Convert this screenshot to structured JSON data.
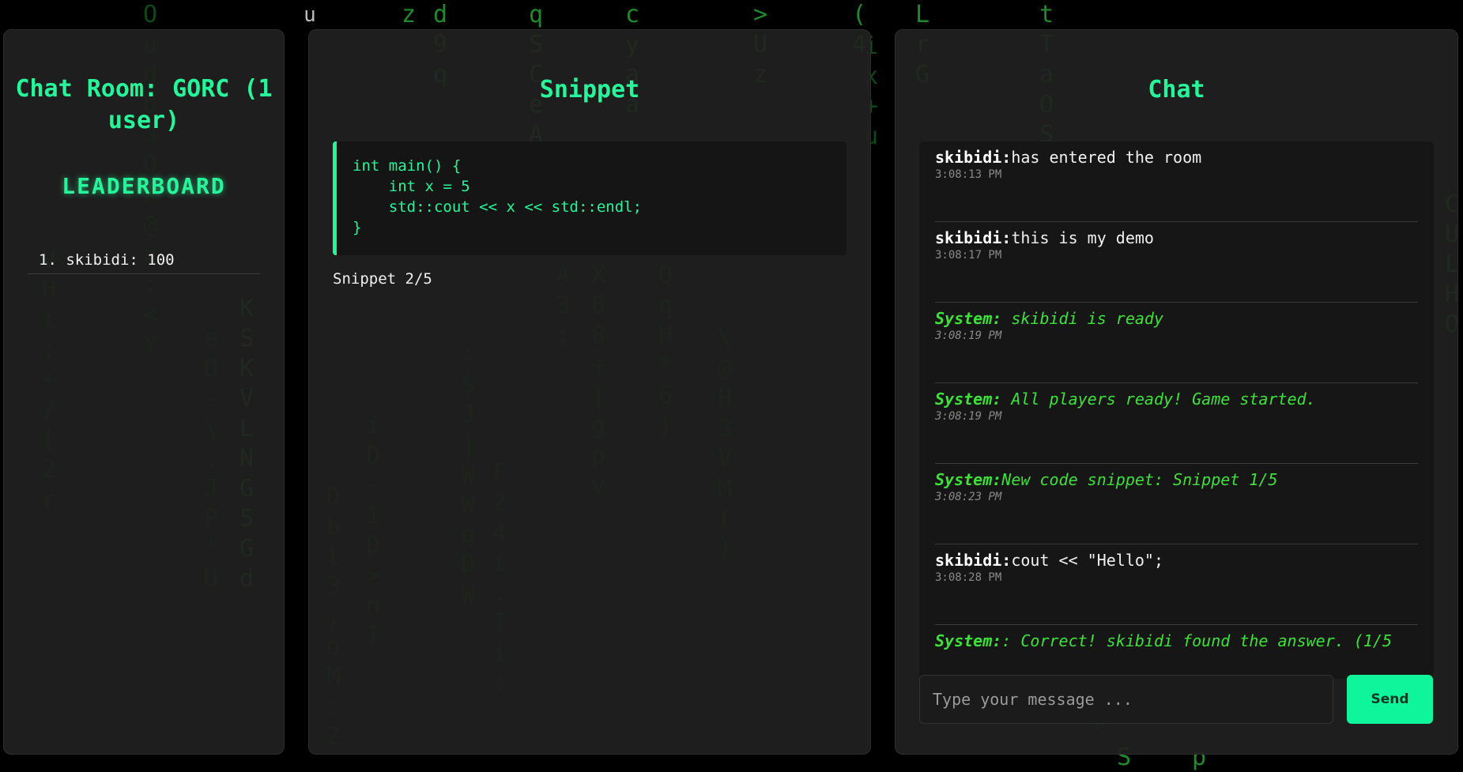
{
  "left": {
    "room_title": "Chat Room: GORC (1 user)",
    "leaderboard_title": "LEADERBOARD",
    "leaderboard": [
      "1. skibidi: 100"
    ]
  },
  "snippet": {
    "title": "Snippet",
    "code": [
      "int main() {",
      "    int x = 5",
      "    std::cout << x << std::endl;",
      "}"
    ],
    "counter": "Snippet 2/5"
  },
  "chat": {
    "title": "Chat",
    "messages": [
      {
        "user": "skibidi:",
        "text": "has entered the room",
        "time": "3:08:13 PM",
        "system": false
      },
      {
        "user": "skibidi:",
        "text": "this is my demo",
        "time": "3:08:17 PM",
        "system": false
      },
      {
        "user": "System:",
        "text": " skibidi is ready",
        "time": "3:08:19 PM",
        "system": true
      },
      {
        "user": "System:",
        "text": " All players ready! Game started.",
        "time": "3:08:19 PM",
        "system": true
      },
      {
        "user": "System:",
        "text": "New code snippet: Snippet 1/5",
        "time": "3:08:23 PM",
        "system": true
      },
      {
        "user": "skibidi:",
        "text": "cout << \"Hello\";",
        "time": "3:08:28 PM",
        "system": false
      },
      {
        "user": "System:",
        "text": ": Correct! skibidi found the answer. (1/5",
        "time": "",
        "system": true
      }
    ],
    "input_placeholder": "Type your message ...",
    "send_label": "Send"
  },
  "background_rain": [
    "O",
    "u",
    "zd",
    "q",
    "c",
    ">",
    "(",
    "L",
    "t",
    "9",
    "S",
    "y",
    "U",
    "4",
    "r",
    "T",
    "#",
    "q",
    "C",
    "a",
    "A",
    "X",
    "Q",
    "3",
    "6",
    "q",
    "8",
    "H",
    "K",
    "S",
    "V",
    "L",
    "N",
    "G",
    "5",
    "G",
    "U",
    "d",
    "W",
    "M",
    "T"
  ]
}
